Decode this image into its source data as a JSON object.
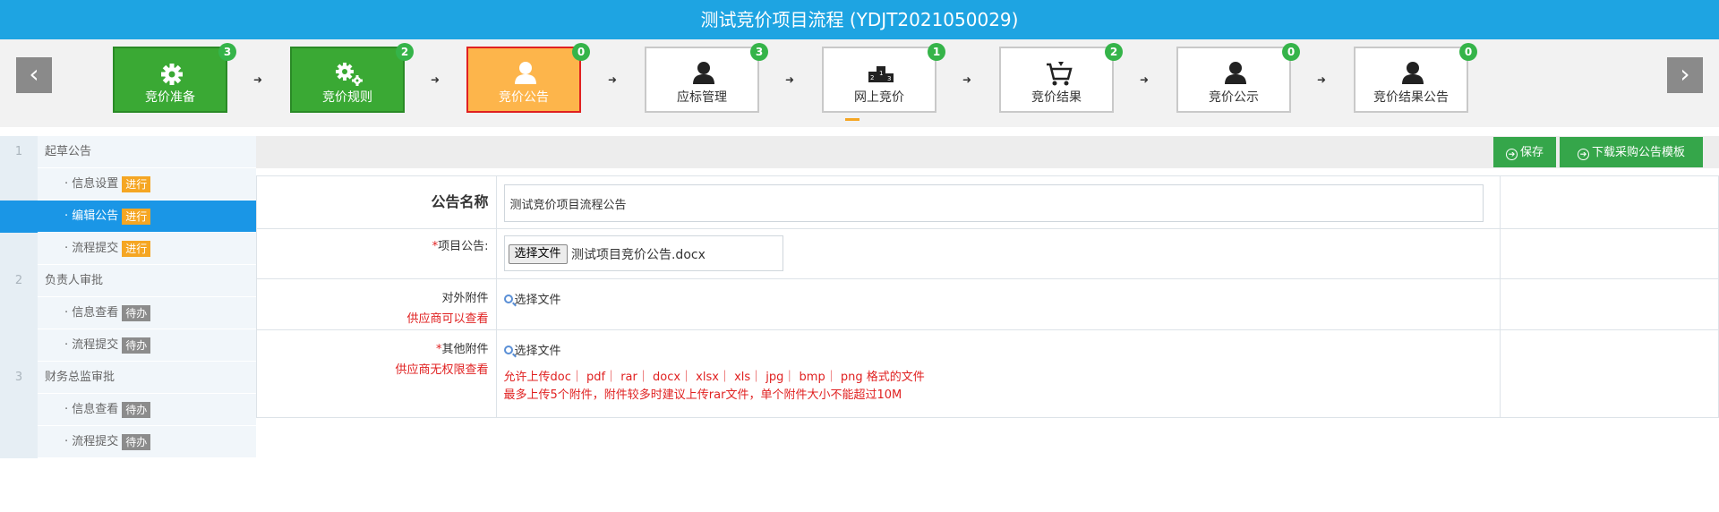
{
  "header": {
    "title": "测试竞价项目流程 (YDJT2021050029)"
  },
  "nav": {
    "prev_icon": "chevron-left",
    "next_icon": "chevron-right"
  },
  "steps": [
    {
      "label": "竞价准备",
      "count": "3",
      "status": "done",
      "icon": "gear-icon"
    },
    {
      "label": "竞价规则",
      "count": "2",
      "status": "done",
      "icon": "gears-icon"
    },
    {
      "label": "竞价公告",
      "count": "0",
      "status": "current",
      "icon": "user-icon"
    },
    {
      "label": "应标管理",
      "count": "3",
      "status": "pending",
      "icon": "user-icon"
    },
    {
      "label": "网上竞价",
      "count": "1",
      "status": "pending",
      "icon": "podium-icon"
    },
    {
      "label": "竞价结果",
      "count": "2",
      "status": "pending",
      "icon": "cart-icon"
    },
    {
      "label": "竞价公示",
      "count": "0",
      "status": "pending",
      "icon": "user-icon"
    },
    {
      "label": "竞价结果公告",
      "count": "0",
      "status": "pending",
      "icon": "user-icon"
    }
  ],
  "sidebar": {
    "groups": [
      {
        "num": "1",
        "label": "起草公告",
        "items": [
          {
            "label": "· 信息设置",
            "tag": "进行",
            "active": false
          },
          {
            "label": "· 编辑公告",
            "tag": "进行",
            "active": true
          },
          {
            "label": "· 流程提交",
            "tag": "进行",
            "active": false
          }
        ]
      },
      {
        "num": "2",
        "label": "负责人审批",
        "items": [
          {
            "label": "· 信息查看",
            "tag": "待办",
            "active": false
          },
          {
            "label": "· 流程提交",
            "tag": "待办",
            "active": false
          }
        ]
      },
      {
        "num": "3",
        "label": "财务总监审批",
        "items": [
          {
            "label": "· 信息查看",
            "tag": "待办",
            "active": false
          },
          {
            "label": "· 流程提交",
            "tag": "待办",
            "active": false
          }
        ]
      }
    ]
  },
  "toolbar": {
    "save_label": "保存",
    "download_label": "下载采购公告模板"
  },
  "form": {
    "name_label": "公告名称",
    "name_value": "测试竞价项目流程公告",
    "announcement_label": "项目公告:",
    "announcement_required": "*",
    "choose_file_button": "选择文件",
    "announcement_file": "测试项目竞价公告.docx",
    "external_label": "对外附件",
    "external_note": "供应商可以查看",
    "external_pick": "选择文件",
    "other_label": "其他附件",
    "other_required": "*",
    "other_note": "供应商无权限查看",
    "other_pick": "选择文件",
    "hint_formats": "允许上传doc｜ pdf｜ rar｜ docx｜ xlsx｜ xls｜ jpg｜ bmp｜ png 格式的文件",
    "hint_limit": "最多上传5个附件，附件较多时建议上传rar文件，单个附件大小不能超过10M"
  },
  "colors": {
    "header": "#1ea4e2",
    "done": "#3aa934",
    "current": "#fdb54b",
    "active_sidebar": "#1a96e6",
    "run_tag": "#f5a623",
    "todo_tag": "#8c8c8c",
    "button": "#35a64a",
    "warning_text": "#e02121"
  }
}
